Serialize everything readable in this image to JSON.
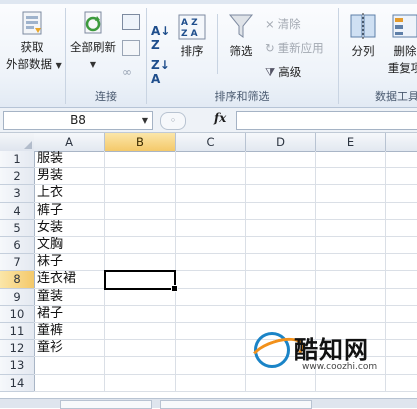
{
  "ribbon": {
    "get_external": {
      "line1": "获取",
      "line2": "外部数据"
    },
    "connections": {
      "refresh_all": "全部刷新",
      "group_label": "连接"
    },
    "sort_filter": {
      "sort_label": "排序",
      "filter_label": "筛选",
      "clear_label": "清除",
      "reapply_label": "重新应用",
      "advanced_label": "高级",
      "group_label": "排序和筛选"
    },
    "data_tools": {
      "split_label": "分列",
      "remove_dup_line1": "删除",
      "remove_dup_line2": "重复项",
      "group_label": "数据工具"
    }
  },
  "formula_bar": {
    "name_box": "B8",
    "fx": "fx",
    "formula": ""
  },
  "columns": [
    "A",
    "B",
    "C",
    "D",
    "E"
  ],
  "rows": [
    "1",
    "2",
    "3",
    "4",
    "5",
    "6",
    "7",
    "8",
    "9",
    "10",
    "11",
    "12",
    "13",
    "14"
  ],
  "column_a": [
    "服装",
    "男装",
    "上衣",
    "裤子",
    "女装",
    "文胸",
    "袜子",
    "连衣裙",
    "童装",
    "裙子",
    "童裤",
    "童衫",
    "",
    ""
  ],
  "watermark": {
    "name": "酷知网",
    "url": "www.coozhi.com"
  },
  "colors": {
    "selection": "#000000",
    "active_header": "#f4c96a",
    "accent": "#1b84c7"
  }
}
